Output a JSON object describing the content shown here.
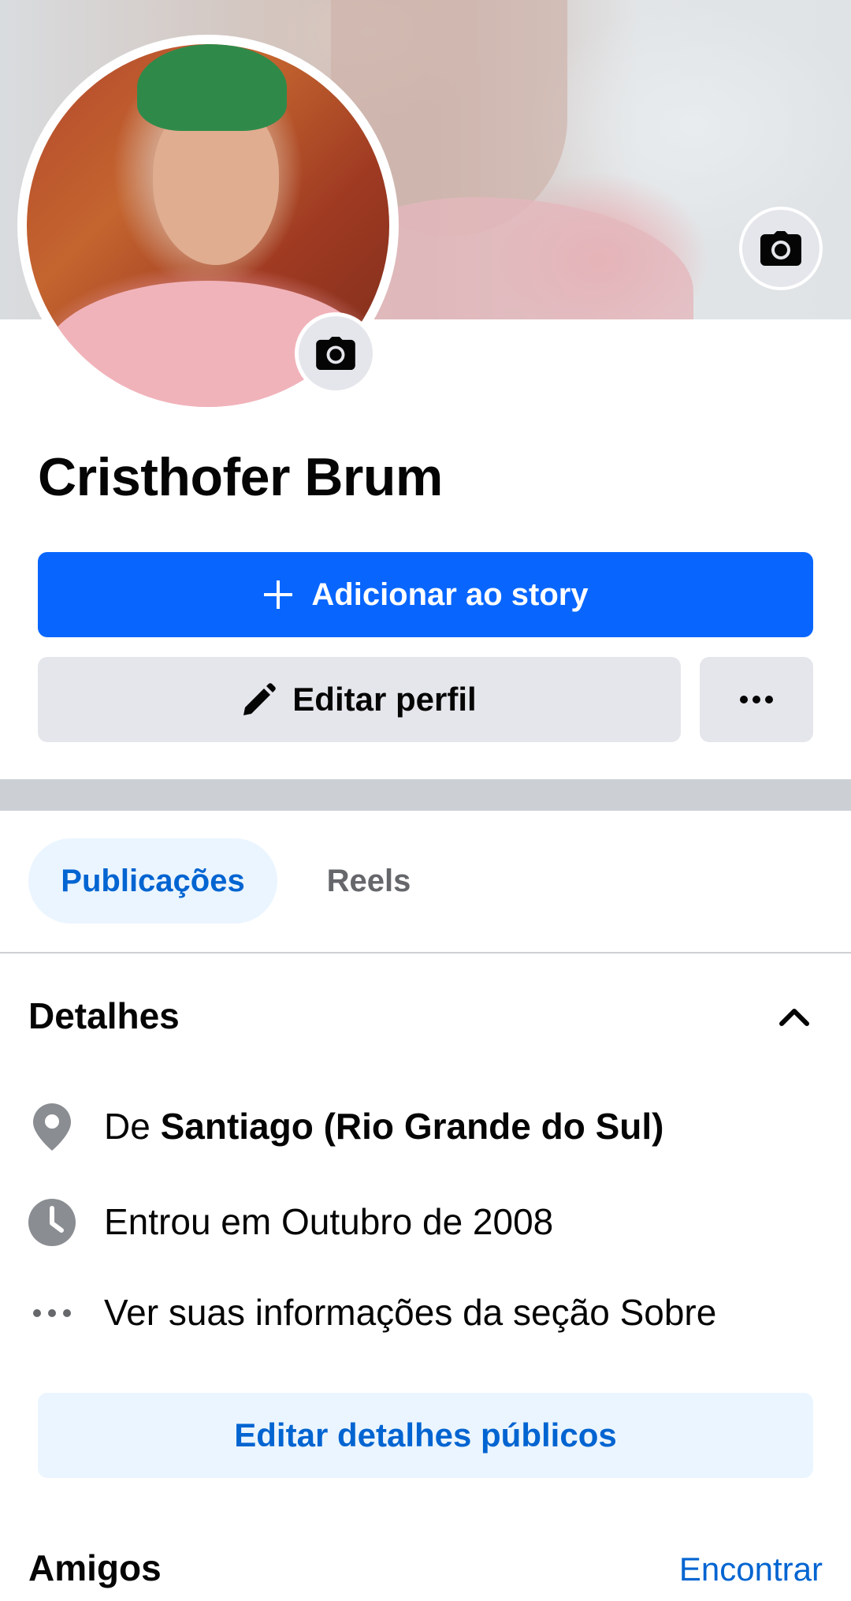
{
  "profile": {
    "name": "Cristhofer Brum"
  },
  "actions": {
    "add_story_icon": "plus-icon",
    "add_story_label": "Adicionar ao story",
    "edit_profile_icon": "pencil-icon",
    "edit_profile_label": "Editar perfil",
    "more_icon": "ellipsis-icon"
  },
  "tabs": [
    {
      "label": "Publicações",
      "selected": true
    },
    {
      "label": "Reels",
      "selected": false
    }
  ],
  "details": {
    "title": "Detalhes",
    "collapse_icon": "chevron-up-icon",
    "items": [
      {
        "icon": "location-pin-icon",
        "prefix": "De ",
        "value": "Santiago (Rio Grande do Sul)"
      },
      {
        "icon": "clock-icon",
        "text": "Entrou em Outubro de 2008"
      },
      {
        "icon": "ellipsis-icon",
        "text": "Ver suas informações da seção Sobre"
      }
    ],
    "edit_button": "Editar detalhes públicos"
  },
  "friends": {
    "title": "Amigos",
    "find_link": "Encontrar"
  },
  "colors": {
    "primary": "#0866ff",
    "link": "#0064d1",
    "secondary_button": "#e4e6eb",
    "tab_selected_bg": "#ebf5ff"
  }
}
